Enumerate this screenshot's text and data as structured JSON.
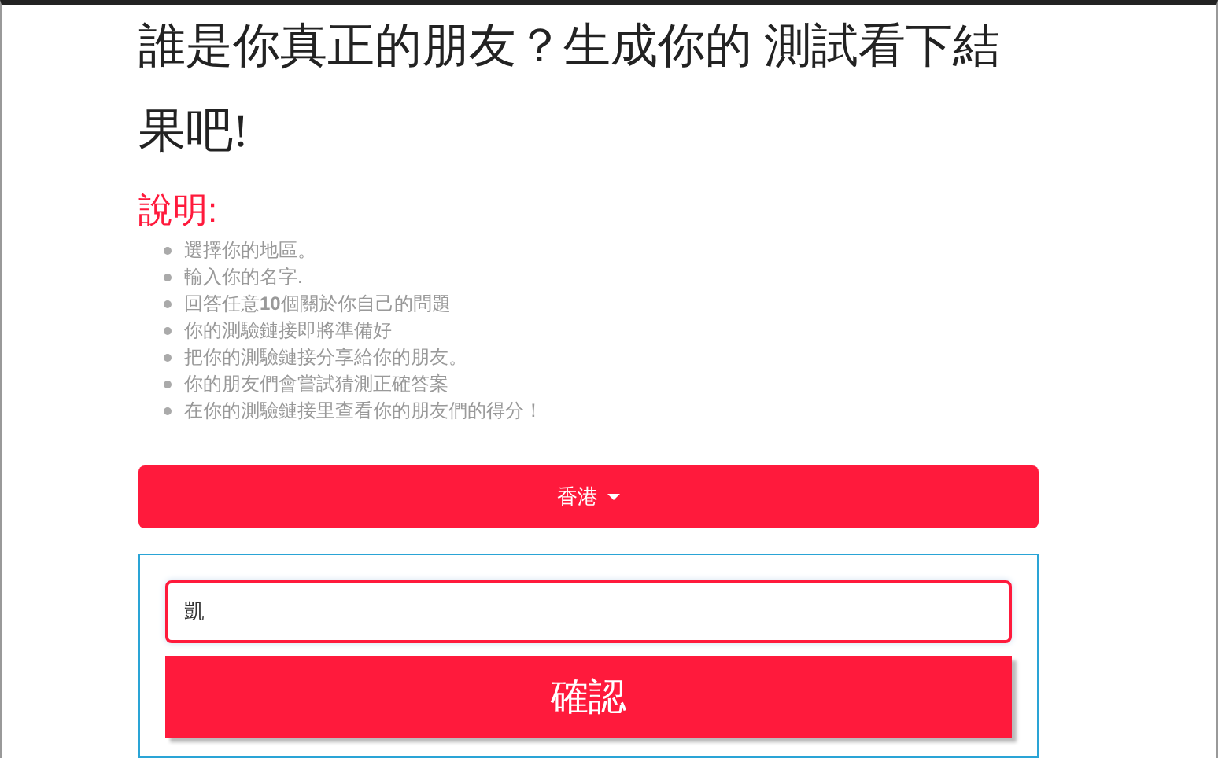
{
  "title": "誰是你真正的朋友？生成你的 測試看下結果吧!",
  "instructions": {
    "heading": "說明:",
    "items": [
      "選擇你的地區。",
      "輸入你的名字.",
      "回答任意**10**個關於你自己的問題",
      "你的測驗鏈接即將準備好",
      "把你的測驗鏈接分享給你的朋友。",
      "你的朋友們會嘗試猜測正確答案",
      "在你的測驗鏈接里查看你的朋友們的得分！"
    ]
  },
  "region_dropdown": {
    "label": "香港"
  },
  "name_form": {
    "name_value": "凱",
    "submit": "確認"
  }
}
